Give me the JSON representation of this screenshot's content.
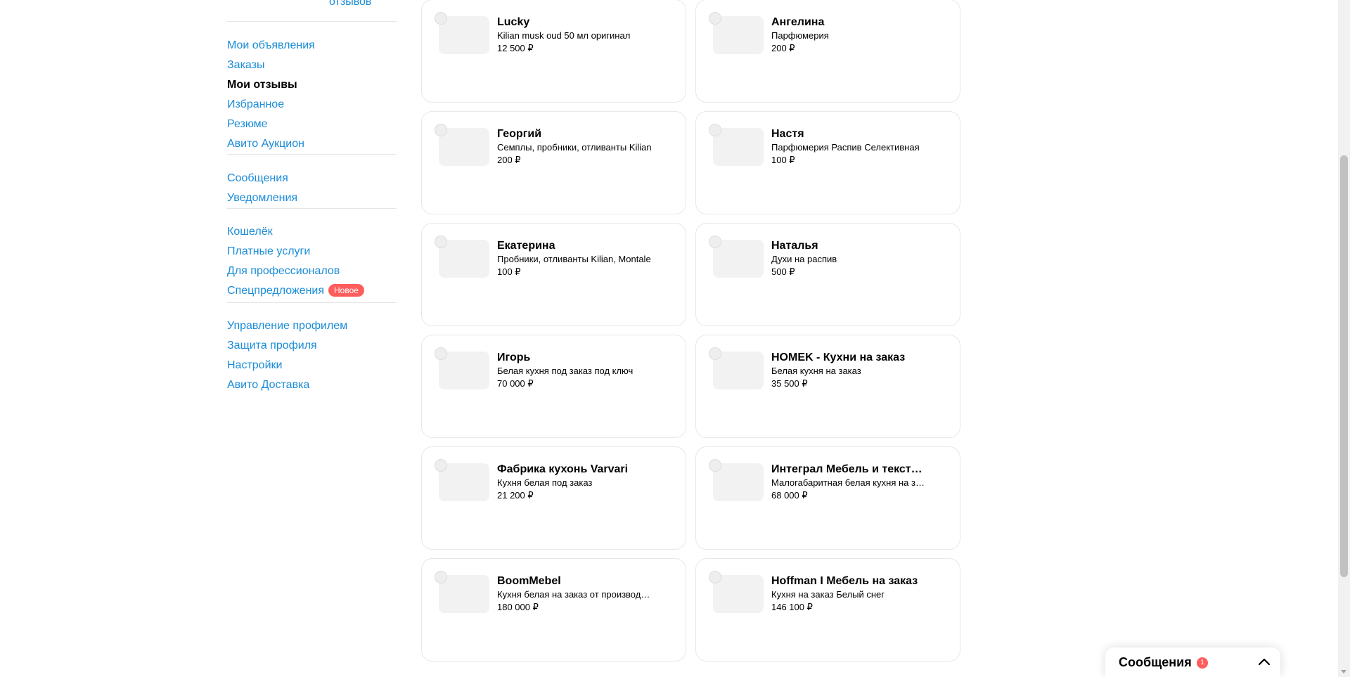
{
  "sidebar": {
    "reviews_link": "отзывов",
    "groups": [
      [
        {
          "label": "Мои объявления",
          "active": false
        },
        {
          "label": "Заказы",
          "active": false
        },
        {
          "label": "Мои отзывы",
          "active": true
        },
        {
          "label": "Избранное",
          "active": false
        },
        {
          "label": "Резюме",
          "active": false
        },
        {
          "label": "Авито Аукцион",
          "active": false
        }
      ],
      [
        {
          "label": "Сообщения",
          "active": false
        },
        {
          "label": "Уведомления",
          "active": false
        }
      ],
      [
        {
          "label": "Кошелёк",
          "active": false
        },
        {
          "label": "Платные услуги",
          "active": false
        },
        {
          "label": "Для профессионалов",
          "active": false
        },
        {
          "label": "Спецпредложения",
          "active": false,
          "badge": "Новое"
        }
      ],
      [
        {
          "label": "Управление профилем",
          "active": false
        },
        {
          "label": "Защита профиля",
          "active": false
        },
        {
          "label": "Настройки",
          "active": false
        },
        {
          "label": "Авито Доставка",
          "active": false
        }
      ]
    ]
  },
  "cards": [
    {
      "name": "Lucky",
      "desc": "Kilian musk oud 50 мл оригинал",
      "price": "12 500 ₽"
    },
    {
      "name": "Ангелина",
      "desc": "Парфюмерия",
      "price": "200 ₽"
    },
    {
      "name": "Георгий",
      "desc": "Семплы, пробники, отливанты Kilian",
      "price": "200 ₽"
    },
    {
      "name": "Настя",
      "desc": "Парфюмерия Распив Селективная",
      "price": "100 ₽"
    },
    {
      "name": "Екатерина",
      "desc": "Пробники, отливанты Kilian, Montale",
      "price": "100 ₽"
    },
    {
      "name": "Наталья",
      "desc": "Духи на распив",
      "price": "500 ₽"
    },
    {
      "name": "Игорь",
      "desc": "Белая кухня под заказ под ключ",
      "price": "70 000 ₽"
    },
    {
      "name": "HOMEK - Кухни на заказ",
      "desc": "Белая кухня на заказ",
      "price": "35 500 ₽"
    },
    {
      "name": "Фабрика кухонь Varvari",
      "desc": "Кухня белая под заказ",
      "price": "21 200 ₽"
    },
    {
      "name": "Интеграл Мебель и текстиль",
      "desc": "Малогабаритная белая кухня на заказ",
      "price": "68 000 ₽"
    },
    {
      "name": "BoomMebel",
      "desc": "Кухня белая на заказ от производителя",
      "price": "180 000 ₽"
    },
    {
      "name": "Hoffman I Мебель на заказ",
      "desc": "Кухня на заказ Белый снег",
      "price": "146 100 ₽"
    }
  ],
  "messages_widget": {
    "title": "Сообщения",
    "count": "1"
  },
  "colors": {
    "link": "#1a8cd8",
    "badge": "#ff5c5c",
    "card_border": "#e8e8e8",
    "thumb": "#f2f2f2"
  }
}
